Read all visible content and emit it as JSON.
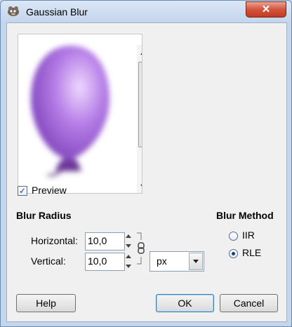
{
  "window": {
    "title": "Gaussian Blur",
    "close_label": "✕",
    "app_icon": "gimp-icon"
  },
  "preview": {
    "image": "purple-balloon-blurred",
    "checkbox_checked": true,
    "checkbox_mark": "✓",
    "checkbox_label": "Preview"
  },
  "blur_radius": {
    "title": "Blur Radius",
    "horizontal_label": "Horizontal:",
    "horizontal_value": "10,0",
    "vertical_label": "Vertical:",
    "vertical_value": "10,0",
    "unit": "px",
    "chain_icon": "chain-link-icon"
  },
  "blur_method": {
    "title": "Blur Method",
    "options": [
      {
        "label": "IIR",
        "selected": false
      },
      {
        "label": "RLE",
        "selected": true
      }
    ]
  },
  "buttons": {
    "help": "Help",
    "ok": "OK",
    "cancel": "Cancel"
  },
  "colors": {
    "balloon": "#9b5fd4",
    "close_button": "#c94a30",
    "default_button_border": "#3c7fb1"
  }
}
